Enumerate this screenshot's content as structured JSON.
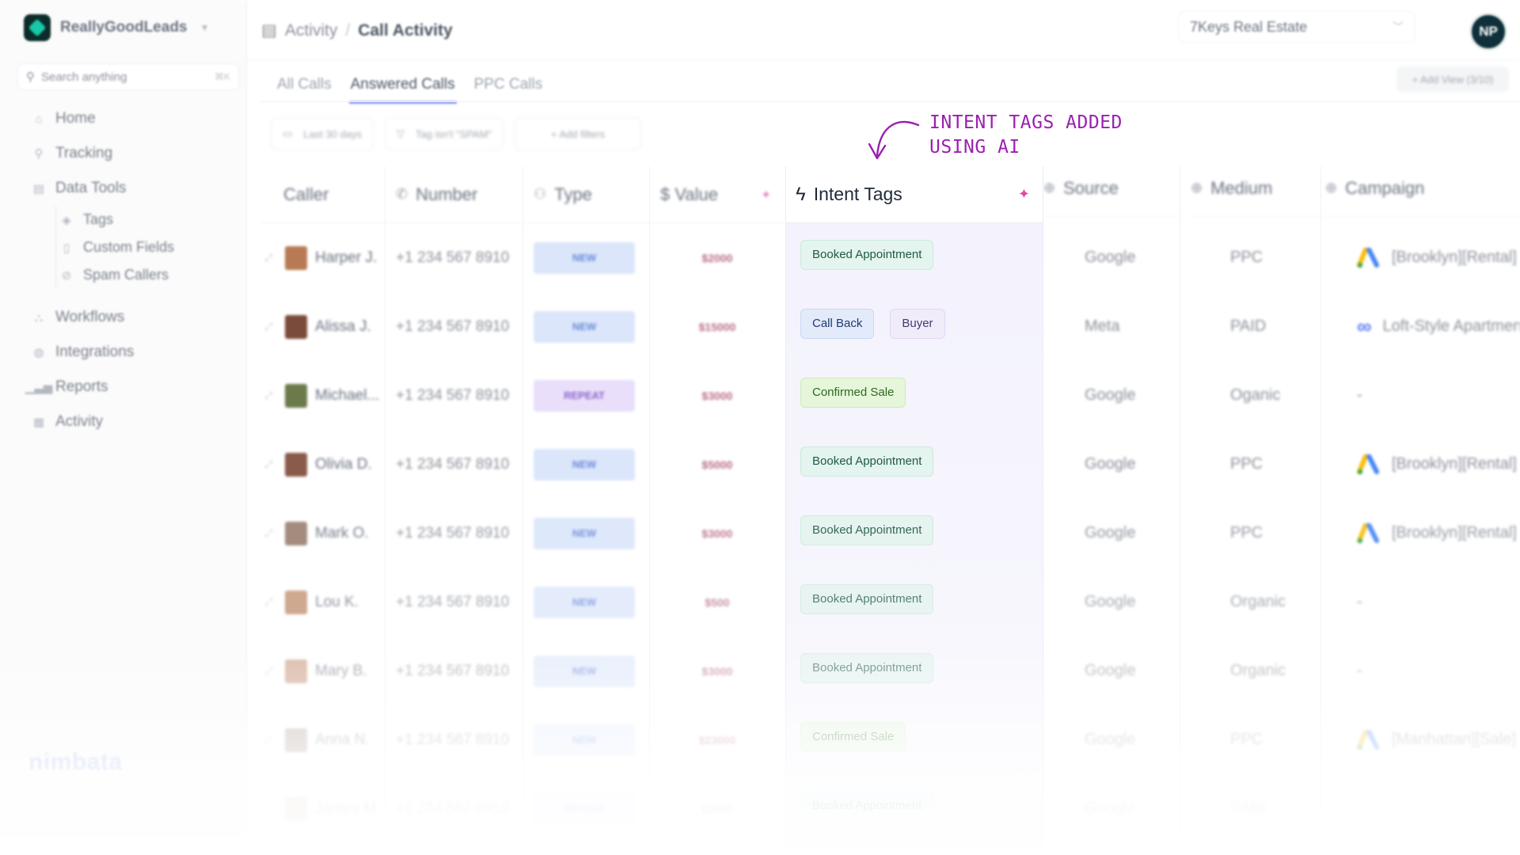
{
  "app": {
    "brand": "ReallyGoodLeads",
    "footer_logo": "nimbata"
  },
  "search": {
    "placeholder": "Search anything",
    "shortcut": "⌘K"
  },
  "nav": {
    "items": [
      {
        "label": "Home",
        "icon": "home-icon"
      },
      {
        "label": "Tracking",
        "icon": "tracking-icon"
      },
      {
        "label": "Data Tools",
        "icon": "data-tools-icon"
      }
    ],
    "sub_items": [
      {
        "label": "Tags",
        "icon": "tag-icon"
      },
      {
        "label": "Custom Fields",
        "icon": "file-icon"
      },
      {
        "label": "Spam Callers",
        "icon": "block-icon"
      }
    ],
    "items2": [
      {
        "label": "Workflows",
        "icon": "workflow-icon"
      },
      {
        "label": "Integrations",
        "icon": "integrations-icon"
      },
      {
        "label": "Reports",
        "icon": "reports-icon"
      },
      {
        "label": "Activity",
        "icon": "activity-icon"
      }
    ]
  },
  "header": {
    "breadcrumb_parent": "Activity",
    "breadcrumb_sep": "/",
    "breadcrumb_current": "Call Activity",
    "account": "7Keys Real Estate",
    "avatar_initials": "NP"
  },
  "tabs": [
    {
      "label": "All Calls",
      "active": false
    },
    {
      "label": "Answered Calls",
      "active": true
    },
    {
      "label": "PPC Calls",
      "active": false
    }
  ],
  "add_view_label": "+ Add View (3/10)",
  "filters": {
    "date": "Last 30 days",
    "tag": "Tag isn't \"SPAM\"",
    "add": "+ Add filters"
  },
  "columns": {
    "caller": "Caller",
    "number": "Number",
    "type": "Type",
    "value": "$ Value",
    "intent": "Intent Tags",
    "source": "Source",
    "medium": "Medium",
    "campaign": "Campaign"
  },
  "rows": [
    {
      "caller": "Harper J.",
      "number": "+1 234 567 8910",
      "type": "NEW",
      "value": "$2000",
      "tags": [
        "Booked Appointment"
      ],
      "source": "Google",
      "medium": "PPC",
      "campaign": "[Brooklyn][Rental]",
      "campaign_icon": "google-ads",
      "face": "#b87a52",
      "opacity": 1
    },
    {
      "caller": "Alissa J.",
      "number": "+1 234 567 8910",
      "type": "NEW",
      "value": "$15000",
      "tags": [
        "Call Back",
        "Buyer"
      ],
      "source": "Meta",
      "medium": "PAID",
      "campaign": "Loft-Style Apartments",
      "campaign_icon": "meta",
      "face": "#7a4a3a",
      "opacity": 1
    },
    {
      "caller": "Michael...",
      "number": "+1 234 567 8910",
      "type": "REPEAT",
      "value": "$3000",
      "tags": [
        "Confirmed Sale"
      ],
      "source": "Google",
      "medium": "Oganic",
      "campaign": "-",
      "campaign_icon": "",
      "face": "#6b7a4a",
      "opacity": 1
    },
    {
      "caller": "Olivia D.",
      "number": "+1 234 567 8910",
      "type": "NEW",
      "value": "$5000",
      "tags": [
        "Booked Appointment"
      ],
      "source": "Google",
      "medium": "PPC",
      "campaign": "[Brooklyn][Rental]",
      "campaign_icon": "google-ads",
      "face": "#8a5a4a",
      "opacity": 1
    },
    {
      "caller": "Mark O.",
      "number": "+1 234 567 8910",
      "type": "NEW",
      "value": "$3000",
      "tags": [
        "Booked Appointment"
      ],
      "source": "Google",
      "medium": "PPC",
      "campaign": "[Brooklyn][Rental]",
      "campaign_icon": "google-ads",
      "face": "#9a8070",
      "opacity": 0.9
    },
    {
      "caller": "Lou K.",
      "number": "+1 234 567 8910",
      "type": "NEW",
      "value": "$500",
      "tags": [
        "Booked Appointment"
      ],
      "source": "Google",
      "medium": "Organic",
      "campaign": "-",
      "campaign_icon": "",
      "face": "#c08a6a",
      "opacity": 0.75
    },
    {
      "caller": "Mary B.",
      "number": "+1 234 567 8910",
      "type": "NEW",
      "value": "$3000",
      "tags": [
        "Booked Appointment"
      ],
      "source": "Google",
      "medium": "Organic",
      "campaign": "-",
      "campaign_icon": "",
      "face": "#c9957a",
      "opacity": 0.6
    },
    {
      "caller": "Anna N.",
      "number": "+1 234 567 8910",
      "type": "NEW",
      "value": "$23000",
      "tags": [
        "Confirmed Sale"
      ],
      "source": "Google",
      "medium": "PPC",
      "campaign": "[Manhattan][Sale]",
      "campaign_icon": "google-ads",
      "face": "#9a8a80",
      "opacity": 0.45
    },
    {
      "caller": "James M.",
      "number": "+1 234 567 8910",
      "type": "REPEAT",
      "value": "$3000",
      "tags": [
        "Booked Appointment"
      ],
      "source": "Google",
      "medium": "GMB",
      "campaign": "",
      "campaign_icon": "",
      "face": "#c6a890",
      "opacity": 0.28
    }
  ],
  "annotation": {
    "line1": "INTENT TAGS ADDED",
    "line2": "USING AI"
  },
  "colors": {
    "accent": "#7c8ff0",
    "annotation": "#9b1fb0",
    "new_badge_bg": "#dbe6fb",
    "repeat_badge_bg": "#eadffa"
  }
}
